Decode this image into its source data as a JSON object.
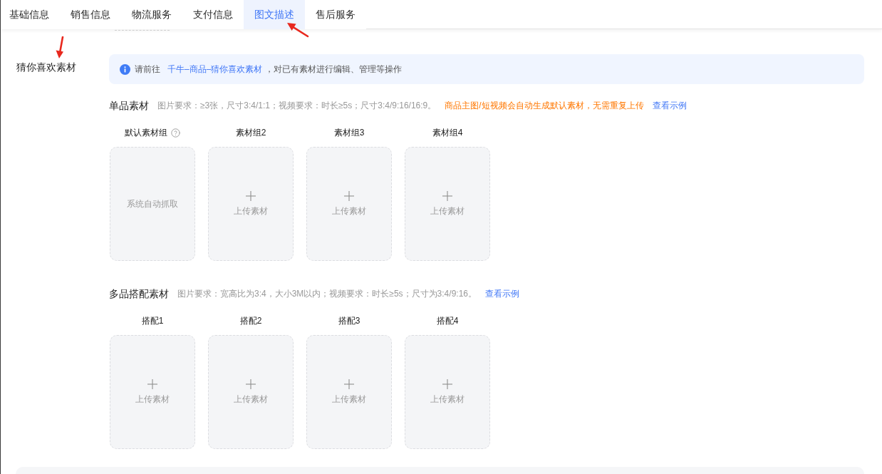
{
  "tabs": [
    {
      "label": "基础信息",
      "selected": false
    },
    {
      "label": "销售信息",
      "selected": false
    },
    {
      "label": "物流服务",
      "selected": false
    },
    {
      "label": "支付信息",
      "selected": false
    },
    {
      "label": "图文描述",
      "selected": true
    },
    {
      "label": "售后服务",
      "selected": false
    }
  ],
  "section_label": "猜你喜欢素材",
  "notice": {
    "prefix": "请前往",
    "link": "千牛–商品–猜你喜欢素材",
    "suffix": "，对已有素材进行编辑、管理等操作"
  },
  "groups": [
    {
      "title": "单品素材",
      "requirements": "图片要求：≥3张，尺寸3:4/1:1；视频要求：时长≥5s；尺寸3:4/9:16/16:9。",
      "highlight": "商品主图/短视频会自动生成默认素材，无需重复上传",
      "example_link": "查看示例",
      "slots": [
        {
          "label": "默认素材组",
          "help": true,
          "kind": "auto",
          "text": "系统自动抓取"
        },
        {
          "label": "素材组2",
          "help": false,
          "kind": "upload",
          "text": "上传素材"
        },
        {
          "label": "素材组3",
          "help": false,
          "kind": "upload",
          "text": "上传素材"
        },
        {
          "label": "素材组4",
          "help": false,
          "kind": "upload",
          "text": "上传素材"
        }
      ]
    },
    {
      "title": "多品搭配素材",
      "requirements": "图片要求：宽高比为3:4，大小3M以内；视频要求：时长≥5s；尺寸为3:4/9:16。",
      "example_link": "查看示例",
      "slots": [
        {
          "label": "搭配1",
          "help": false,
          "kind": "upload",
          "text": "上传素材"
        },
        {
          "label": "搭配2",
          "help": false,
          "kind": "upload",
          "text": "上传素材"
        },
        {
          "label": "搭配3",
          "help": false,
          "kind": "upload",
          "text": "上传素材"
        },
        {
          "label": "搭配4",
          "help": false,
          "kind": "upload",
          "text": "上传素材"
        }
      ]
    }
  ]
}
